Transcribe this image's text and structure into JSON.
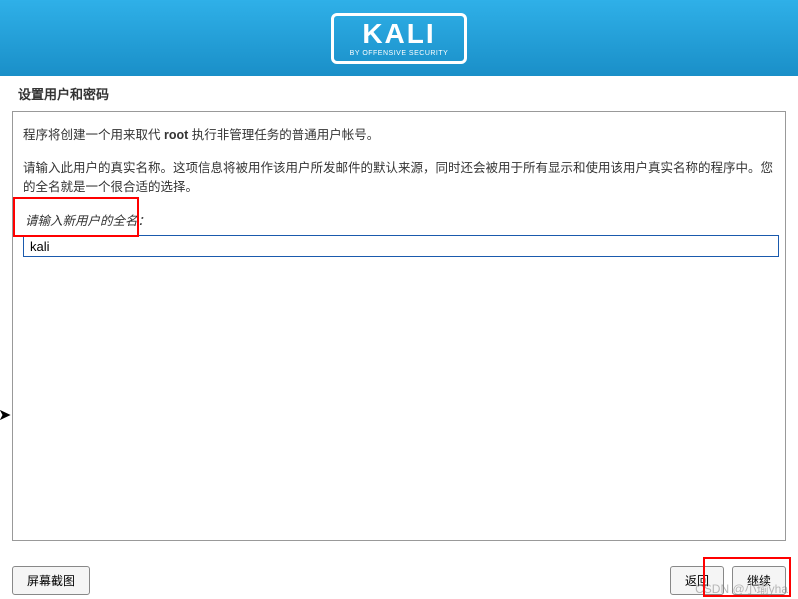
{
  "header": {
    "logo_text": "KALI",
    "logo_subtitle": "BY OFFENSIVE SECURITY"
  },
  "section_title": "设置用户和密码",
  "main": {
    "desc1_pre": "程序将创建一个用来取代 ",
    "desc1_bold": "root",
    "desc1_post": " 执行非管理任务的普通用户帐号。",
    "desc2": "请输入此用户的真实名称。这项信息将被用作该用户所发邮件的默认来源，同时还会被用于所有显示和使用该用户真实名称的程序中。您的全名就是一个很合适的选择。",
    "input_label": "请输入新用户的全名：",
    "input_value": "kali"
  },
  "footer": {
    "screenshot_btn": "屏幕截图",
    "back_btn": "返回",
    "continue_btn": "继续"
  },
  "watermark": "CSDN @小瑜yha"
}
